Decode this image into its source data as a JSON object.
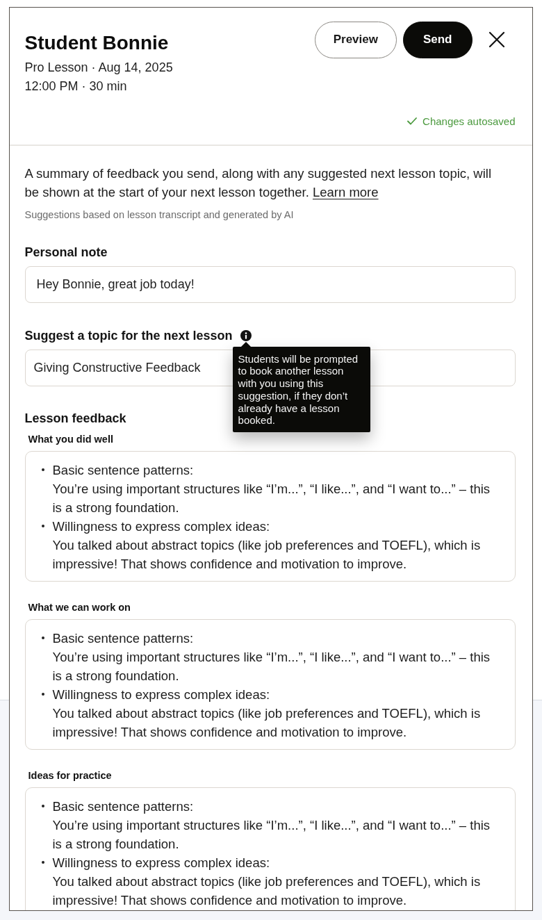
{
  "header": {
    "title": "Student Bonnie",
    "meta_lines": [
      "Pro Lesson · Aug 14, 2025",
      "12:00 PM · 30 min"
    ],
    "buttons": [
      {
        "label": "Preview",
        "kind": "secondary"
      },
      {
        "label": "Send",
        "kind": "primary"
      }
    ],
    "autosave_status": "Changes autosaved"
  },
  "intro": {
    "text": "A summary of feedback you send, along with any suggested next lesson topic, will be shown at the start of your next lesson together.",
    "link": "Learn more",
    "note": "Suggestions based on lesson transcript and generated by AI"
  },
  "personal_note": {
    "label": "Personal note",
    "value": "Hey Bonnie, great job today!"
  },
  "next_topic": {
    "label": "Suggest a topic for the next lesson",
    "value": "Giving Constructive Feedback",
    "tooltip": "Students will be prompted to book another lesson with you using this suggestion, if they don’t already have a lesson booked."
  },
  "lesson_feedback": {
    "title": "Lesson feedback",
    "sections": [
      {
        "label": "What you did well",
        "items": [
          {
            "heading": "Basic sentence patterns:",
            "text": "You’re using important structures like “I’m...”, “I like...”, and “I want to...” – this is a strong foundation."
          },
          {
            "heading": "Willingness to express complex ideas:",
            "text": "You talked about abstract topics (like job preferences and TOEFL), which is impressive! That shows confidence and motivation to improve."
          }
        ]
      },
      {
        "label": "What we can work on",
        "items": [
          {
            "heading": "Basic sentence patterns:",
            "text": "You’re using important structures like “I’m...”, “I like...”, and “I want to...” – this is a strong foundation."
          },
          {
            "heading": "Willingness to express complex ideas:",
            "text": "You talked about abstract topics (like job preferences and TOEFL), which is impressive! That shows confidence and motivation to improve."
          }
        ]
      },
      {
        "label": "Ideas for practice",
        "items": [
          {
            "heading": "Basic sentence patterns:",
            "text": "You’re using important structures like “I’m...”, “I like...”, and “I want to...” – this is a strong foundation."
          },
          {
            "heading": "Willingness to express complex ideas:",
            "text": "You talked about abstract topics (like job preferences and TOEFL), which is impressive! That shows confidence and motivation to improve."
          }
        ]
      }
    ]
  }
}
